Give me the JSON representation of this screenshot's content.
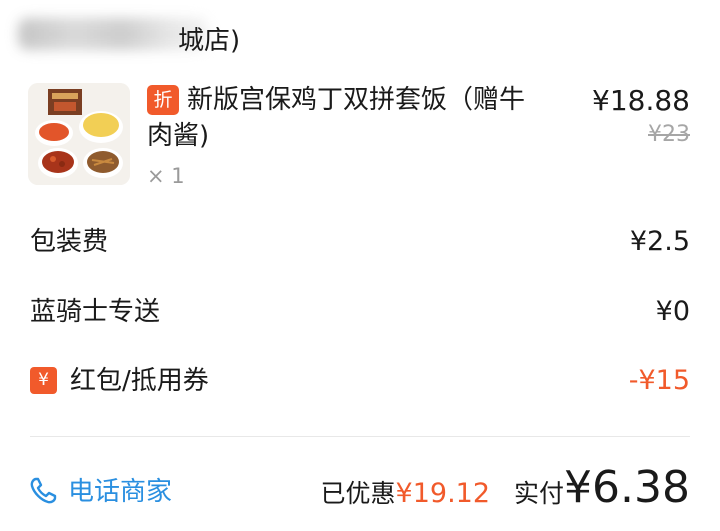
{
  "shop": {
    "name_visible": "城店)"
  },
  "product": {
    "badge": "折",
    "name": "新版宫保鸡丁双拼套饭（赠牛肉酱)",
    "price": "¥18.88",
    "original_price": "¥23",
    "quantity": "× 1"
  },
  "fees": {
    "packaging": {
      "label": "包装费",
      "value": "¥2.5"
    },
    "delivery": {
      "label": "蓝骑士专送",
      "value": "¥0"
    },
    "coupon": {
      "icon_glyph": "¥",
      "label": "红包/抵用券",
      "value": "-¥15"
    }
  },
  "footer": {
    "call_label": "电话商家",
    "discount_label": "已优惠",
    "discount_amount": "¥19.12",
    "paid_label": "实付",
    "paid_amount": "¥6.38"
  },
  "colors": {
    "accent_orange": "#f15a2b",
    "link_blue": "#2a8fe0"
  }
}
